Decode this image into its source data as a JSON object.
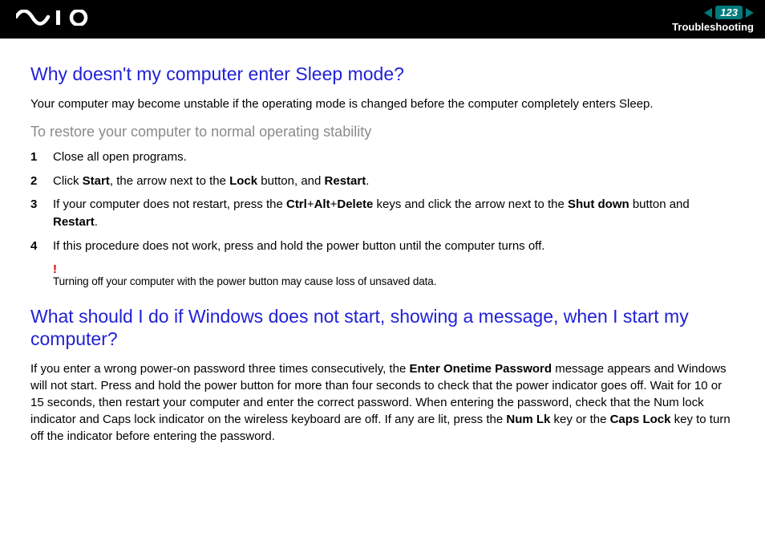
{
  "header": {
    "page_number": "123",
    "section": "Troubleshooting"
  },
  "q1": {
    "heading": "Why doesn't my computer enter Sleep mode?",
    "intro": "Your computer may become unstable if the operating mode is changed before the computer completely enters Sleep.",
    "subhead": "To restore your computer to normal operating stability",
    "steps": {
      "s1": "Close all open programs.",
      "s2_a": "Click ",
      "s2_b": "Start",
      "s2_c": ", the arrow next to the ",
      "s2_d": "Lock",
      "s2_e": " button, and ",
      "s2_f": "Restart",
      "s2_g": ".",
      "s3_a": "If your computer does not restart, press the ",
      "s3_b": "Ctrl",
      "s3_c": "+",
      "s3_d": "Alt",
      "s3_e": "+",
      "s3_f": "Delete",
      "s3_g": " keys and click the arrow next to the ",
      "s3_h": "Shut down",
      "s3_i": " button and ",
      "s3_j": "Restart",
      "s3_k": ".",
      "s4": "If this procedure does not work, press and hold the power button until the computer turns off."
    },
    "note_mark": "!",
    "note": "Turning off your computer with the power button may cause loss of unsaved data."
  },
  "q2": {
    "heading": "What should I do if Windows does not start, showing a message, when I start my computer?",
    "p_a": "If you enter a wrong power-on password three times consecutively, the ",
    "p_b": "Enter Onetime Password",
    "p_c": " message appears and Windows will not start. Press and hold the power button for more than four seconds to check that the power indicator goes off. Wait for 10 or 15 seconds, then restart your computer and enter the correct password. When entering the password, check that the Num lock indicator and Caps lock indicator on the wireless keyboard are off. If any are lit, press the ",
    "p_d": "Num Lk",
    "p_e": " key or the ",
    "p_f": "Caps Lock",
    "p_g": " key to turn off the indicator before entering the password."
  }
}
